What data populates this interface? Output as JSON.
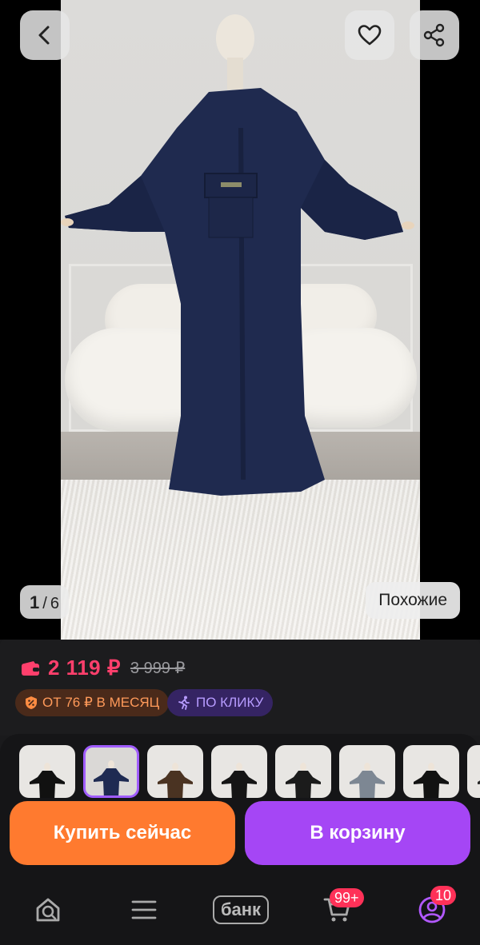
{
  "gallery": {
    "current": "1",
    "separator": "/",
    "total": "6",
    "similar_label": "Похожие"
  },
  "header": {
    "back_icon": "chevron-left-icon",
    "favorite_icon": "heart-icon",
    "share_icon": "share-icon"
  },
  "pricing": {
    "price": "2 119 ₽",
    "old_price": "3 999 ₽",
    "installment_badge": "ОТ 76 ₽ В МЕСЯЦ",
    "click_badge": "ПО КЛИКУ",
    "price_color": "#ff3f6c"
  },
  "variants": {
    "count_visible": 8,
    "selected_index": 1,
    "colors": [
      "#111111",
      "#1e2a52",
      "#4a3322",
      "#151515",
      "#1b1b1b",
      "#7d8793",
      "#121212",
      "#2a2a2a"
    ]
  },
  "actions": {
    "buy_now": "Купить сейчас",
    "add_to_cart": "В корзину",
    "buy_color": "#ff7a2f",
    "cart_color": "#a546f5"
  },
  "tabbar": {
    "bank_label": "банк",
    "cart_badge": "99+",
    "profile_badge": "10"
  }
}
